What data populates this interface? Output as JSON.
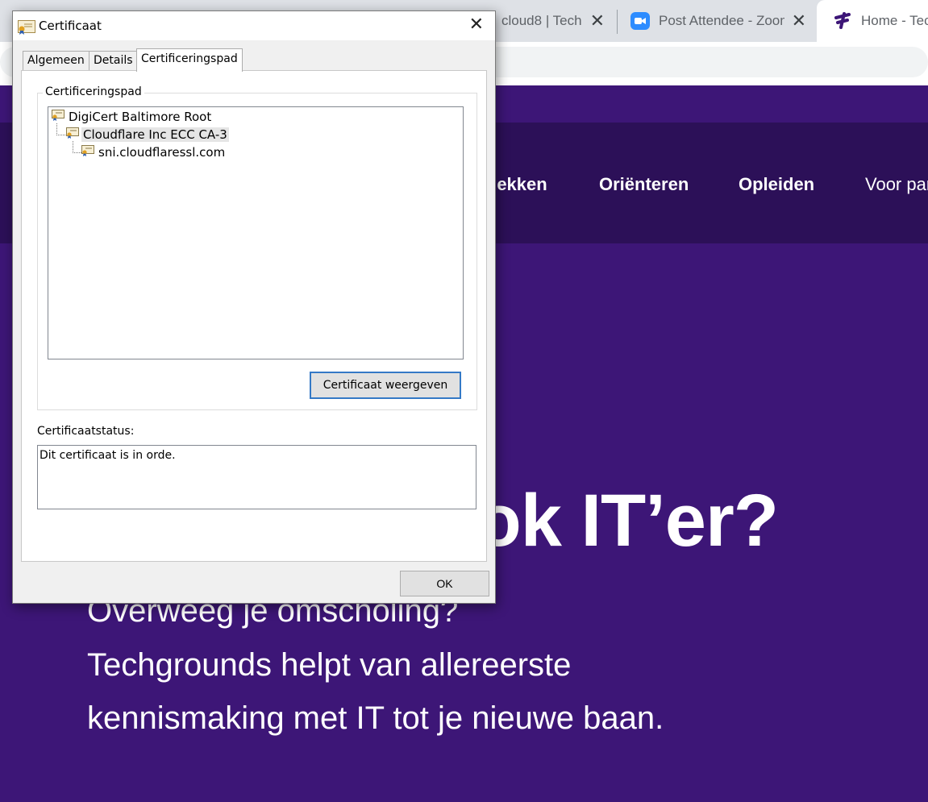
{
  "browser": {
    "tabs": [
      {
        "title": "cloud8 | Tech",
        "icon": "generic-icon"
      },
      {
        "title": "Post Attendee - Zoom",
        "icon": "zoom-icon"
      },
      {
        "title": "Home - Techgrounds",
        "icon": "techgrounds-icon"
      }
    ],
    "close_glyph": "✕"
  },
  "page": {
    "nav": [
      "Ontdekken",
      "Oriënteren",
      "Opleiden",
      "Voor partners"
    ],
    "hero_title": "Ook IT’er?",
    "hero_lines": [
      "Overweeg je omscholing?",
      "Techgrounds helpt van allereerste",
      "kennismaking met IT tot je nieuwe baan."
    ],
    "colors": {
      "background": "#3d1677",
      "navbar": "#2c1058"
    }
  },
  "dialog": {
    "title": "Certificaat",
    "tabs": [
      "Algemeen",
      "Details",
      "Certificeringspad"
    ],
    "active_tab": "Certificeringspad",
    "path_group_label": "Certificeringspad",
    "path": [
      {
        "label": "DigiCert Baltimore Root",
        "level": 0
      },
      {
        "label": "Cloudflare Inc ECC CA-3",
        "level": 1
      },
      {
        "label": "sni.cloudflaressl.com",
        "level": 2
      }
    ],
    "view_button": "Certificaat weergeven",
    "status_label": "Certificaatstatus:",
    "status_text": "Dit certificaat is in orde.",
    "ok_button": "OK"
  }
}
